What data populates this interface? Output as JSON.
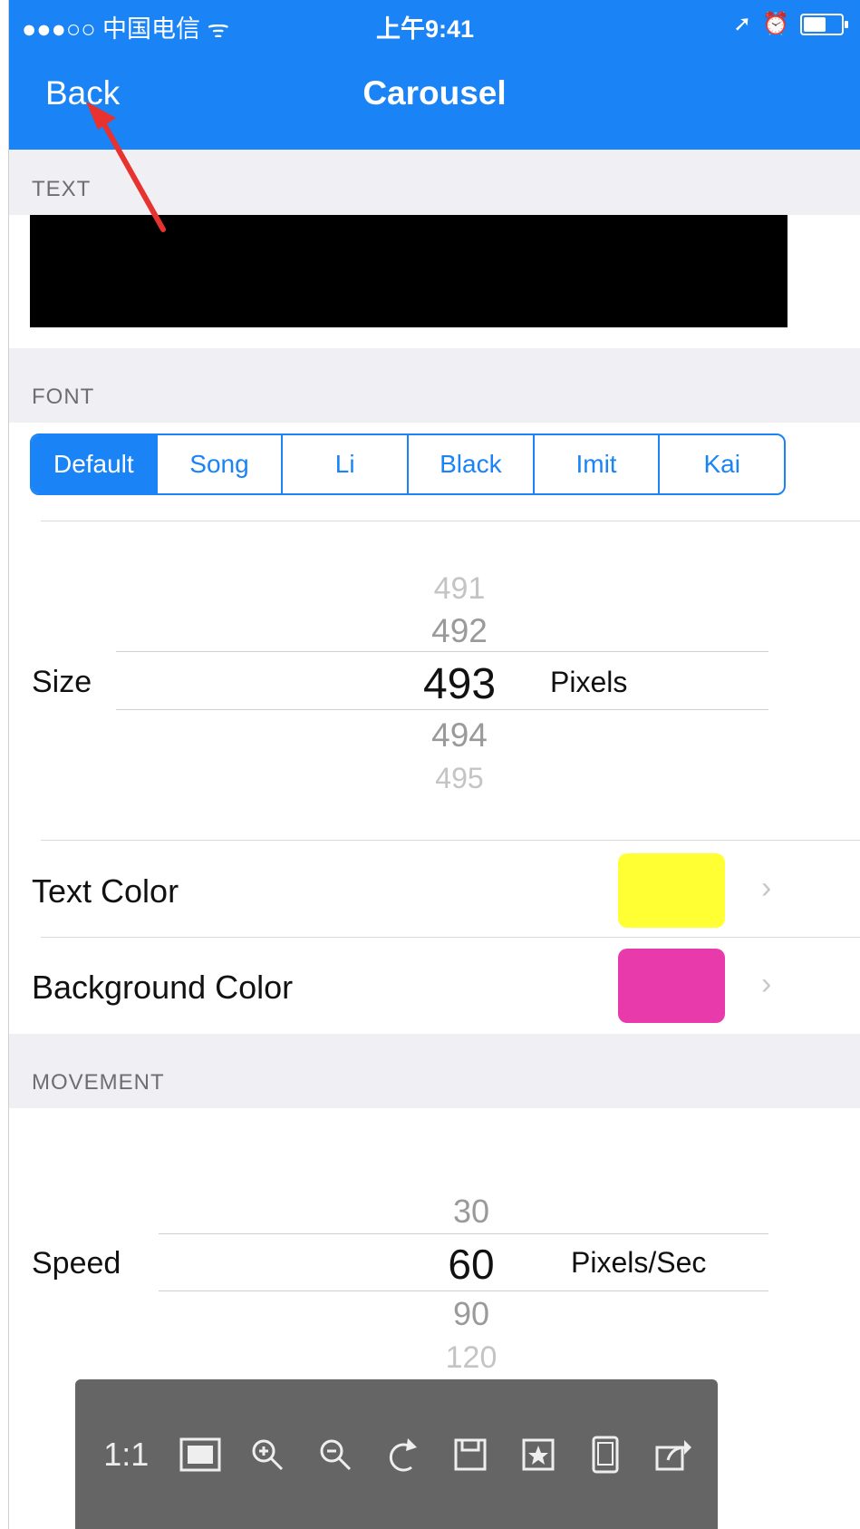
{
  "status_bar": {
    "carrier": "●●●○○ 中国电信 ᯤ",
    "time": "上午9:41",
    "icons": [
      "location-icon",
      "alarm-icon",
      "battery-icon"
    ]
  },
  "nav": {
    "back_label": "Back",
    "title": "Carousel"
  },
  "sections": {
    "text": "TEXT",
    "font": "FONT",
    "movement": "MOVEMENT"
  },
  "font_options": [
    "Default",
    "Song",
    "Li",
    "Black",
    "Imit",
    "Kai"
  ],
  "font_selected": "Default",
  "size_picker": {
    "label": "Size",
    "values": [
      "491",
      "492",
      "493",
      "494",
      "495"
    ],
    "selected": "493",
    "unit": "Pixels"
  },
  "text_color": {
    "label": "Text Color",
    "color": "#ffff33"
  },
  "background_color": {
    "label": "Background Color",
    "color": "#e93aab"
  },
  "speed_picker": {
    "label": "Speed",
    "values": [
      "30",
      "60",
      "90",
      "120"
    ],
    "selected": "60",
    "unit": "Pixels/Sec"
  },
  "viewer_toolbar": {
    "one_to_one": "1:1",
    "icons": [
      "fit-screen-icon",
      "zoom-in-icon",
      "zoom-out-icon",
      "rotate-icon",
      "save-icon",
      "favorite-icon",
      "phone-view-icon",
      "share-icon"
    ]
  },
  "colors": {
    "accent": "#1a83f5",
    "section_bg": "#efeff4",
    "annotation_arrow": "#e8322f"
  }
}
